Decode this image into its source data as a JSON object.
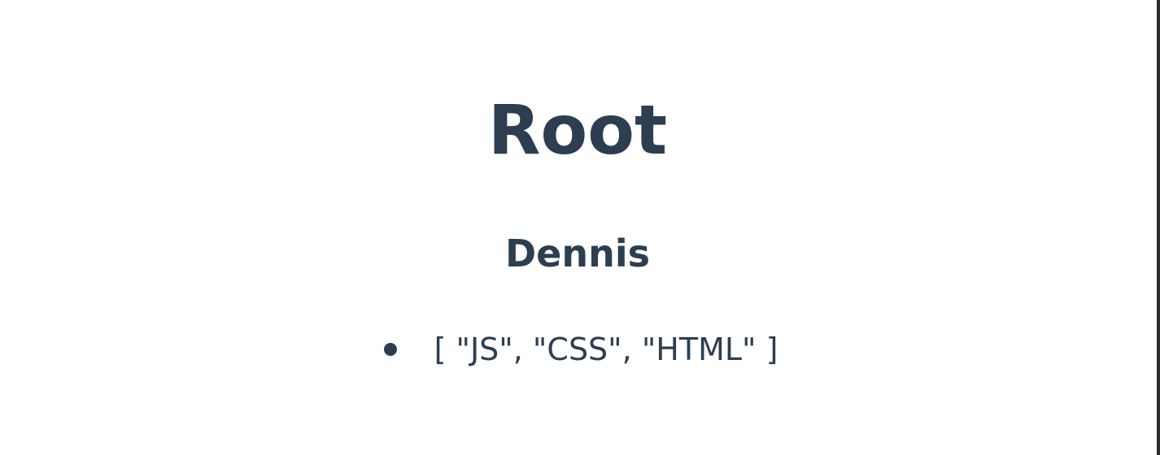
{
  "page": {
    "title": "Root",
    "user": {
      "name": "Dennis",
      "skills_text": "[ \"JS\", \"CSS\", \"HTML\" ]"
    }
  },
  "colors": {
    "text": "#2c3e50",
    "background": "#ffffff",
    "edge": "#2b2b2b"
  }
}
